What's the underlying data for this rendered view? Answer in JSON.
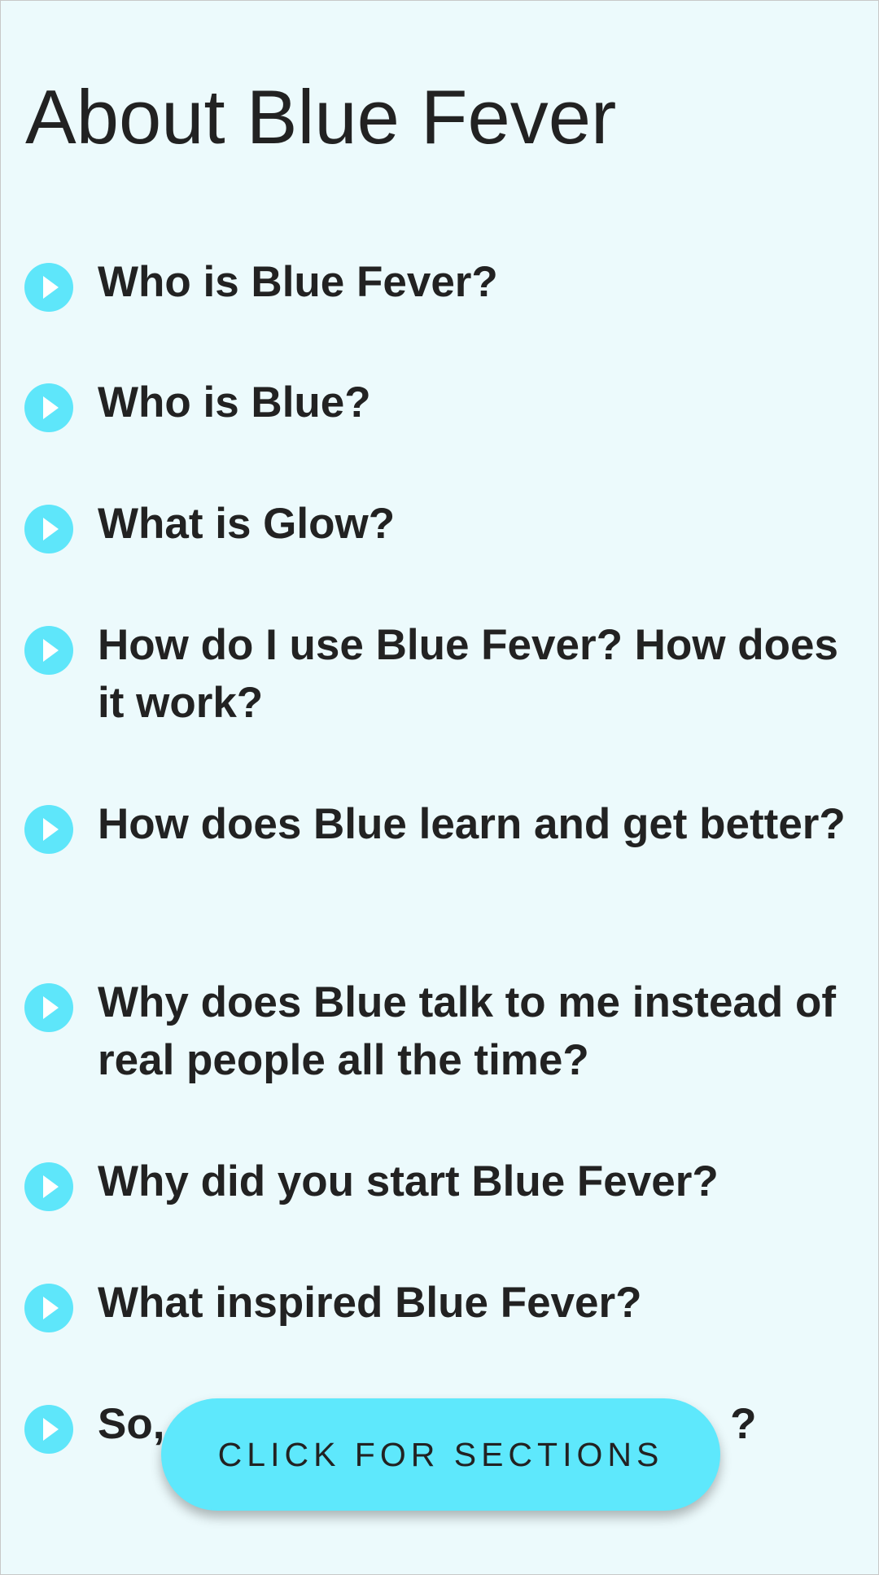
{
  "page": {
    "title": "About Blue Fever"
  },
  "faq": {
    "items": [
      {
        "question": "Who is Blue Fever?",
        "icon": "play-circle-icon"
      },
      {
        "question": "Who is Blue?",
        "icon": "play-circle-icon"
      },
      {
        "question": "What is Glow?",
        "icon": "play-circle-icon"
      },
      {
        "question": "How do I use Blue Fever? How does it work?",
        "icon": "play-circle-icon"
      },
      {
        "question": "How does Blue learn and get better?",
        "icon": "play-circle-icon"
      },
      {
        "question": "Why does Blue talk to me instead of real people all the time?",
        "icon": "play-circle-icon"
      },
      {
        "question": "Why did you start Blue Fever?",
        "icon": "play-circle-icon"
      },
      {
        "question": "What inspired Blue Fever?",
        "icon": "play-circle-icon"
      },
      {
        "question": "So, ?",
        "icon": "play-circle-icon"
      }
    ]
  },
  "floating_button": {
    "label": "CLICK FOR SECTIONS"
  },
  "colors": {
    "background": "#ecfafc",
    "accent": "#5ee8fc",
    "text": "#222222"
  }
}
